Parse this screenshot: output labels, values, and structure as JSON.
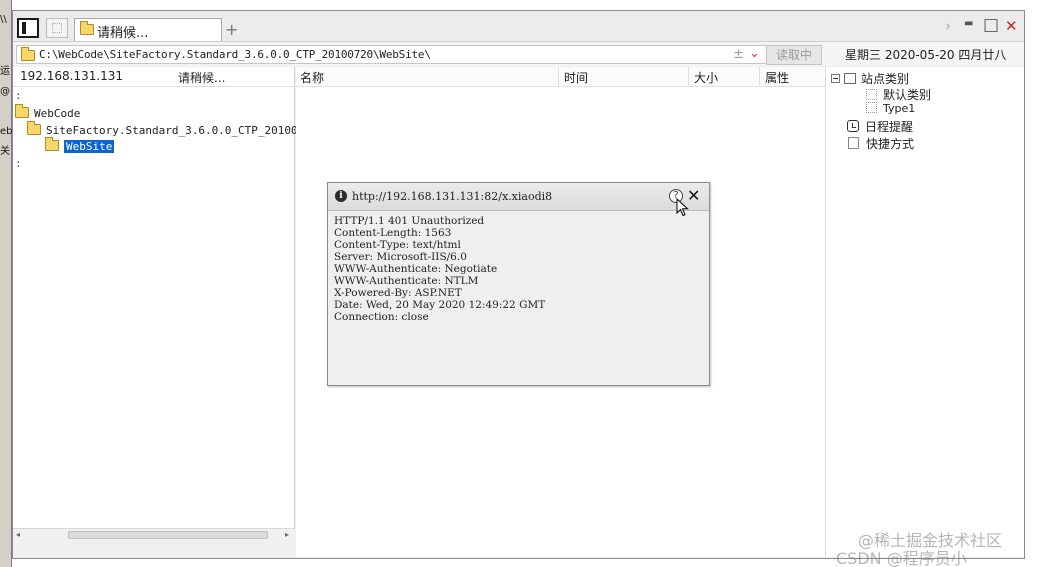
{
  "tab": {
    "label": "请稍候..."
  },
  "window_controls": {
    "forward": "›",
    "minimize": "▬",
    "maximize": "□",
    "close": "✕"
  },
  "address": {
    "path": "C:\\WebCode\\SiteFactory.Standard_3.6.0.0_CTP_20100720\\WebSite\\",
    "star": "±",
    "read_button": "读取中",
    "date": "星期三  2020-05-20  四月廿八"
  },
  "left_pane": {
    "ip": "192.168.131.131",
    "status": "请稍候...",
    "tree": [
      {
        "label": "WebCode"
      },
      {
        "label": "SiteFactory.Standard_3.6.0.0_CTP_20100720"
      },
      {
        "label": "WebSite",
        "selected": true
      }
    ]
  },
  "file_list": {
    "columns": [
      "名称",
      "时间",
      "大小",
      "属性"
    ]
  },
  "right_pane": {
    "category": "站点类别",
    "sub_items": [
      "默认类别",
      "Type1"
    ],
    "schedule": "日程提醒",
    "shortcuts": "快捷方式"
  },
  "popup": {
    "url": "http://192.168.131.131:82/x.xiaodi8",
    "help": "?",
    "close": "✕",
    "response": "HTTP/1.1 401 Unauthorized\nContent-Length: 1563\nContent-Type: text/html\nServer: Microsoft-IIS/6.0\nWWW-Authenticate: Negotiate\nWWW-Authenticate: NTLM\nX-Powered-By: ASP.NET\nDate: Wed, 20 May 2020 12:49:22 GMT\nConnection: close"
  },
  "watermark": {
    "line1": "@稀土掘金技术社区",
    "line2": "CSDN @程序员小"
  }
}
